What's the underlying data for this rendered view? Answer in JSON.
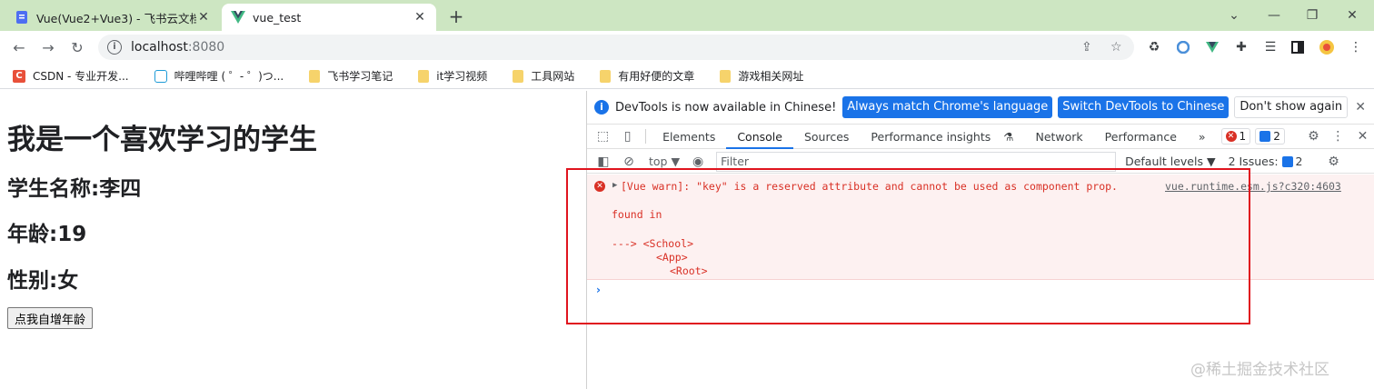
{
  "browser": {
    "tabs": [
      {
        "title": "Vue(Vue2+Vue3) - 飞书云文档",
        "active": false,
        "icon": "docs-icon"
      },
      {
        "title": "vue_test",
        "active": true,
        "icon": "vue-logo-icon"
      }
    ],
    "address": {
      "host": "localhost",
      "port": ":8080"
    },
    "bookmarks": [
      {
        "label": "CSDN - 专业开发...",
        "icon": "csdn-icon"
      },
      {
        "label": "哔哩哔哩 ( ゜- ゜)つ...",
        "icon": "bilibili-icon"
      },
      {
        "label": "飞书学习笔记",
        "icon": "folder-icon"
      },
      {
        "label": "it学习视频",
        "icon": "folder-icon"
      },
      {
        "label": "工具网站",
        "icon": "folder-icon"
      },
      {
        "label": "有用好便的文章",
        "icon": "folder-icon"
      },
      {
        "label": "游戏相关网址",
        "icon": "folder-icon"
      }
    ]
  },
  "page": {
    "heading": "我是一个喜欢学习的学生",
    "student_name": "学生名称:李四",
    "age": "年龄:19",
    "gender": "性别:女",
    "button_label": "点我自增年龄"
  },
  "devtools": {
    "infobar": {
      "message": "DevTools is now available in Chinese!",
      "btn_match": "Always match Chrome's language",
      "btn_switch": "Switch DevTools to Chinese",
      "btn_dismiss": "Don't show again"
    },
    "tabs": [
      "Elements",
      "Console",
      "Sources",
      "Performance insights",
      "Network",
      "Performance"
    ],
    "selected_tab": "Console",
    "error_count": "1",
    "message_count": "2",
    "context": "top",
    "filter_placeholder": "Filter",
    "levels": "Default levels",
    "issues_label": "2 Issues:",
    "issues_count": "2",
    "console": {
      "warning_line1": "[Vue warn]: \"key\" is a reserved attribute and cannot be used as component prop.",
      "found_in": "found in",
      "trace1": "---> <School>",
      "trace2": "<App>",
      "trace3": "<Root>",
      "source": "vue.runtime.esm.js?c320:4603"
    }
  },
  "watermark": "@稀土掘金技术社区",
  "colors": {
    "tabstrip": "#cde6c2",
    "accent": "#1a73e8",
    "error": "#d93025",
    "highlight": "#e0141e"
  }
}
